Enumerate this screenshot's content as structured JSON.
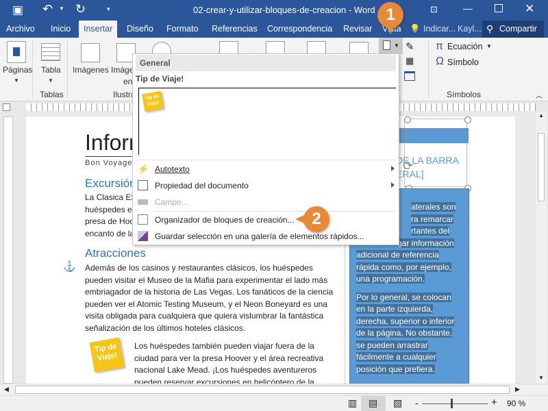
{
  "window": {
    "title": "02-crear-y-utilizar-bloques-de-creacion  -  Word",
    "user": "Kayl...",
    "share": "Compartir",
    "tell_me": "Indicar...",
    "colors": {
      "brand": "#2b579a",
      "callout": "#e8893a",
      "sidebar": "#5b9bd5"
    }
  },
  "tabs": [
    "Archivo",
    "Inicio",
    "Insertar",
    "Diseño",
    "Formato",
    "Referencias",
    "Correspondencia",
    "Revisar",
    "Vista"
  ],
  "ribbon": {
    "paginas": "Páginas",
    "tabla": "Tabla",
    "tablas_group": "Tablas",
    "imagenes": "Imágenes",
    "imagenes_linea_1": "Imágenes",
    "imagenes_linea_2": "en línea",
    "ilustr_group": "Ilustraciones",
    "ecuacion": "Ecuación",
    "simbolo": "Símbolo",
    "simbolos_group": "Símbolos"
  },
  "dropdown": {
    "section": "General",
    "item_title": "Tip de Viaje!",
    "note_text": "Tip de Viaje!",
    "items": [
      {
        "label": "Autotexto",
        "icon": "autotext-icon",
        "submenu": true,
        "disabled": false
      },
      {
        "label": "Propiedad del documento",
        "icon": "document-property-icon",
        "submenu": true,
        "disabled": false
      },
      {
        "label": "Campo...",
        "icon": "field-icon",
        "submenu": false,
        "disabled": true
      },
      {
        "label": "Organizador de bloques de creación...",
        "icon": "building-blocks-organizer-icon",
        "submenu": false,
        "disabled": false
      },
      {
        "label": "Guardar selección en una galería de elementos rápidos...",
        "icon": "save-selection-icon",
        "submenu": false,
        "disabled": false
      }
    ]
  },
  "callouts": [
    "1",
    "2"
  ],
  "document": {
    "title": "Inforr",
    "subtitle": "Bon Voyage",
    "h1": "Excursión",
    "p1": [
      "La Clasica Exc",
      "huéspedes el",
      "presa de Hoo",
      "encanto de la"
    ],
    "h2": "Atracciones",
    "p2": [
      "Además de los casinos y restaurantes clásicos, los huéspedes",
      "pueden visitar el Museo de la Mafia para experimentar el lado más",
      "embriagador de la historia de Las Vegas. Los fanáticos de la ciencia",
      "pueden ver el Atomic Testing Museum, y el Neon Boneyard es una",
      "visita obligada para cualquiera que quiera vislumbrar la fantástica",
      "señalización de los últimos hoteles clásicos."
    ],
    "note": "Tip de Viaje!",
    "p3": [
      "Los huéspedes también pueden viajar fuera de la",
      "ciudad para ver la presa Hoover y el área recreativa",
      "nacional Lake Mead. ¡Los huéspedes aventureros",
      "pueden reservar excursiones en helicóptero de la"
    ],
    "sidebar_title": [
      "DE LA BARRA",
      "ERAL]"
    ],
    "sidebar_p1": [
      "aterales son",
      "ra remarcar",
      "rtantes del",
      "gar información",
      "adicional de referencia",
      "rápida como, por ejemplo,",
      "una programación."
    ],
    "sidebar_p2": [
      "Por lo general, se colocan",
      "en la parte izquierda,",
      "derecha, superior o inferior",
      "de la página. No obstante,",
      "se pueden arrastrar",
      "fácilmente a cualquier",
      "posición que prefiera."
    ]
  },
  "status": {
    "zoom": "90 %"
  }
}
